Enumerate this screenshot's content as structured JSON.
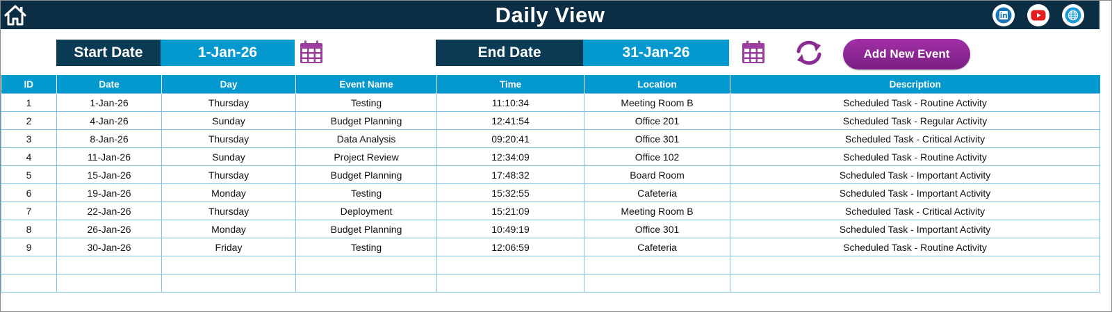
{
  "header": {
    "title": "Daily View"
  },
  "filters": {
    "start_label": "Start Date",
    "start_value": "1-Jan-26",
    "end_label": "End Date",
    "end_value": "31-Jan-26"
  },
  "actions": {
    "add_event_label": "Add New Event"
  },
  "social": [
    "linkedin-icon",
    "youtube-icon",
    "website-icon"
  ],
  "colors": {
    "header_bg": "#0b2e44",
    "accent": "#0399cf",
    "label_bg": "#0b3a55",
    "button": "#8b2a93",
    "calendar": "#9b3ea0"
  },
  "table": {
    "columns": [
      "ID",
      "Date",
      "Day",
      "Event Name",
      "Time",
      "Location",
      "Description"
    ],
    "rows": [
      [
        "1",
        "1-Jan-26",
        "Thursday",
        "Testing",
        "11:10:34",
        "Meeting Room B",
        "Scheduled Task - Routine Activity"
      ],
      [
        "2",
        "4-Jan-26",
        "Sunday",
        "Budget Planning",
        "12:41:54",
        "Office 201",
        "Scheduled Task - Regular Activity"
      ],
      [
        "3",
        "8-Jan-26",
        "Thursday",
        "Data Analysis",
        "09:20:41",
        "Office 301",
        "Scheduled Task - Critical Activity"
      ],
      [
        "4",
        "11-Jan-26",
        "Sunday",
        "Project Review",
        "12:34:09",
        "Office 102",
        "Scheduled Task - Routine Activity"
      ],
      [
        "5",
        "15-Jan-26",
        "Thursday",
        "Budget Planning",
        "17:48:32",
        "Board Room",
        "Scheduled Task - Important Activity"
      ],
      [
        "6",
        "19-Jan-26",
        "Monday",
        "Testing",
        "15:32:55",
        "Cafeteria",
        "Scheduled Task - Important Activity"
      ],
      [
        "7",
        "22-Jan-26",
        "Thursday",
        "Deployment",
        "15:21:09",
        "Meeting Room B",
        "Scheduled Task - Critical Activity"
      ],
      [
        "8",
        "26-Jan-26",
        "Monday",
        "Budget Planning",
        "10:49:19",
        "Office 301",
        "Scheduled Task - Important Activity"
      ],
      [
        "9",
        "30-Jan-26",
        "Friday",
        "Testing",
        "12:06:59",
        "Cafeteria",
        "Scheduled Task - Routine Activity"
      ],
      [
        "",
        "",
        "",
        "",
        "",
        "",
        ""
      ],
      [
        "",
        "",
        "",
        "",
        "",
        "",
        ""
      ]
    ]
  }
}
